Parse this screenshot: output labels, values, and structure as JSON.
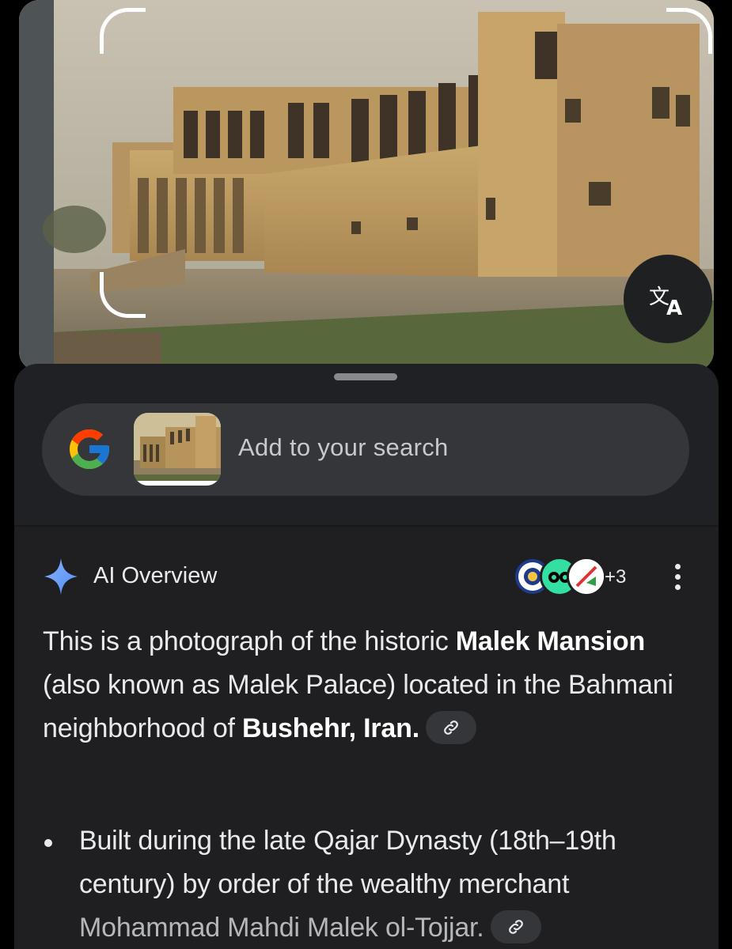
{
  "photo": {
    "subject": "building-photo",
    "translate_icon": "translate-icon"
  },
  "search_bar": {
    "logo": "google-logo-icon",
    "placeholder": "Add to your search"
  },
  "ai_overview": {
    "title": "AI Overview",
    "icon": "sparkle-icon",
    "sources_more": "+3",
    "menu_icon": "more-vert-icon",
    "intro": {
      "t1": "This is a photograph of the historic ",
      "b1": "Malek Mansion",
      "t2": " (also known as Malek Palace) located in the Bahmani neighborhood of ",
      "b2": "Bushehr, Iran.",
      "link_icon": "link-icon"
    },
    "bullets": [
      {
        "text": "Built during the late Qajar Dynasty (18th–19th century) by order of the wealthy merchant ",
        "name": "Mohammad Mahdi Malek ol-Tojjar."
      }
    ]
  },
  "colors": {
    "sheet_bg": "#1f2124",
    "pill_bg": "#34363a",
    "text": "#e8eaed",
    "sparkle": "#4f8df9"
  }
}
